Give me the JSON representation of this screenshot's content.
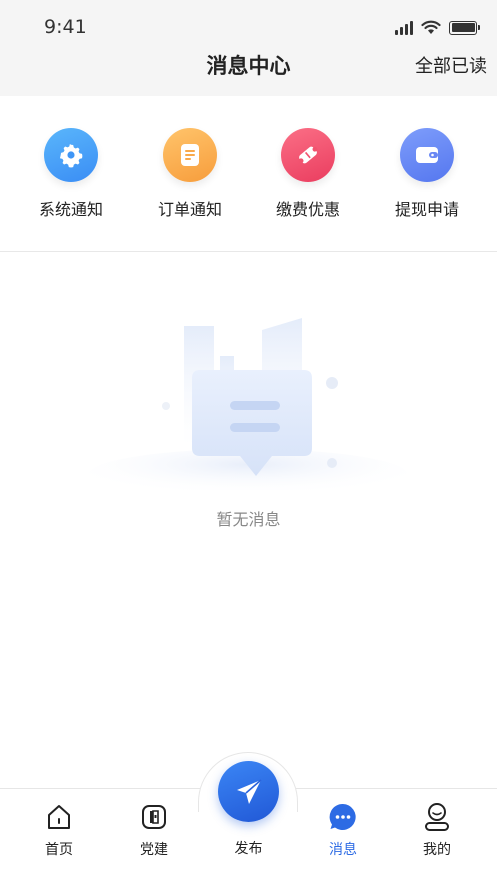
{
  "status_bar": {
    "time": "9:41"
  },
  "header": {
    "title": "消息中心",
    "mark_all_read": "全部已读"
  },
  "categories": [
    {
      "label": "系统通知",
      "icon": "gear-icon",
      "color_from": "#5ab6fb",
      "color_to": "#3a8df5"
    },
    {
      "label": "订单通知",
      "icon": "document-icon",
      "color_from": "#ffc46b",
      "color_to": "#f79d3c"
    },
    {
      "label": "缴费优惠",
      "icon": "coupon-icon",
      "color_from": "#fb6f86",
      "color_to": "#ea3d5f"
    },
    {
      "label": "提现申请",
      "icon": "wallet-icon",
      "color_from": "#7e9dfb",
      "color_to": "#5577ef"
    }
  ],
  "empty_state": {
    "text": "暂无消息"
  },
  "tabbar": {
    "items": [
      {
        "label": "首页",
        "icon": "home-icon"
      },
      {
        "label": "党建",
        "icon": "party-icon"
      },
      {
        "label": "发布",
        "icon": "paper-plane-icon"
      },
      {
        "label": "消息",
        "icon": "chat-bubble-icon",
        "active": true
      },
      {
        "label": "我的",
        "icon": "user-icon"
      }
    ],
    "active_color": "#2d6be4"
  }
}
